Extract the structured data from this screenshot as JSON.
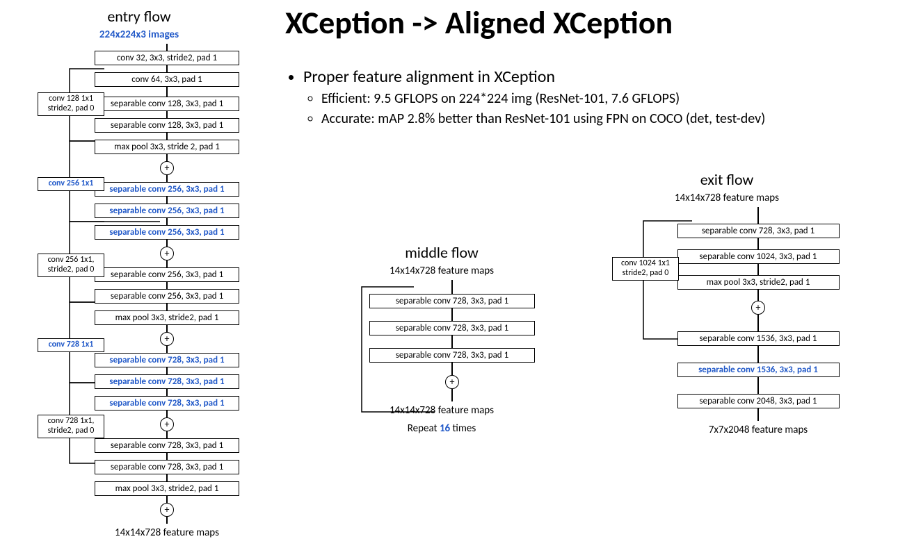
{
  "title": "XCeption -> Aligned XCeption",
  "bullets": {
    "main": "Proper feature alignment in XCeption",
    "sub1": "Efficient: 9.5 GFLOPS on 224*224 img (ResNet-101, 7.6 GFLOPS)",
    "sub2": "Accurate: mAP 2.8% better than ResNet-101 using FPN on COCO (det, test-dev)"
  },
  "entry": {
    "title": "entry flow",
    "input": "224x224x3 images",
    "b1": "conv 32, 3x3, stride2, pad 1",
    "b2": "conv 64, 3x3, pad 1",
    "g1a": "separable conv 128, 3x3, pad 1",
    "g1b": "separable conv 128, 3x3, pad 1",
    "g1c": "max pool 3x3, stride 2, pad 1",
    "s1": "conv 128 1x1 stride2, pad 0",
    "g2a": "separable conv 256, 3x3, pad 1",
    "g2b": "separable conv 256, 3x3, pad 1",
    "g2c": "separable conv 256, 3x3, pad 1",
    "s2": "conv 256 1x1",
    "g3a": "separable conv 256, 3x3, pad 1",
    "g3b": "separable conv 256, 3x3, pad 1",
    "g3c": "max pool 3x3, stride2, pad 1",
    "s3": "conv 256 1x1, stride2, pad 0",
    "g4a": "separable conv 728, 3x3, pad 1",
    "g4b": "separable conv 728, 3x3, pad 1",
    "g4c": "separable conv 728, 3x3, pad 1",
    "s4": "conv 728 1x1",
    "g5a": "separable conv 728, 3x3, pad 1",
    "g5b": "separable conv 728, 3x3, pad 1",
    "g5c": "max pool 3x3, stride2, pad 1",
    "s5": "conv 728 1x1, stride2, pad 0",
    "out": "14x14x728 feature maps"
  },
  "middle": {
    "title": "middle flow",
    "in": "14x14x728 feature maps",
    "b1": "separable conv 728, 3x3, pad 1",
    "b2": "separable conv 728, 3x3, pad 1",
    "b3": "separable conv 728, 3x3, pad 1",
    "out": "14x14x728 feature maps",
    "repeat_pre": "Repeat ",
    "repeat_n": "16",
    "repeat_post": " times"
  },
  "exit": {
    "title": "exit flow",
    "in": "14x14x728 feature maps",
    "g1a": "separable conv 728, 3x3, pad 1",
    "g1b": "separable conv 1024, 3x3, pad 1",
    "g1c": "max pool 3x3, stride2, pad 1",
    "s1": "conv 1024 1x1 stride2, pad 0",
    "b1": "separable conv 1536, 3x3, pad 1",
    "b2": "separable conv 1536, 3x3, pad 1",
    "b3": "separable conv 2048, 3x3, pad 1",
    "out": "7x7x2048 feature maps"
  }
}
